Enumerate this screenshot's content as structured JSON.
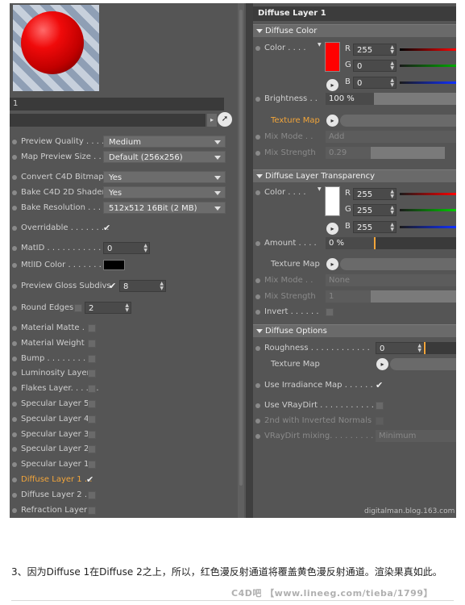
{
  "left_panel": {
    "name_value": "1",
    "rows": [
      {
        "label": "Preview Quality . . . .",
        "value": "Medium",
        "kind": "dropdown"
      },
      {
        "label": "Map Preview Size . .",
        "value": "Default (256x256)",
        "kind": "dropdown"
      },
      {
        "label": "Convert C4D Bitmaps",
        "value": "Yes",
        "kind": "dropdown"
      },
      {
        "label": "Bake C4D 2D Shaders",
        "value": "Yes",
        "kind": "dropdown"
      },
      {
        "label": "Bake Resolution . . . .",
        "value": "512x512  16Bit  (2 MB)",
        "kind": "dropdown"
      },
      {
        "label": "Overridable . . . . . . . .",
        "checked": true
      },
      {
        "label": "MatID . . . . . . . . . . . .",
        "value": "0"
      },
      {
        "label": "MtlID Color . . . . . . . ."
      },
      {
        "label": "Preview Gloss Subdivs",
        "value": "8",
        "checked": true
      },
      {
        "label": "Round Edges",
        "value": "2",
        "checked": false
      }
    ],
    "layers": [
      {
        "label": "Material Matte . .",
        "checked": false
      },
      {
        "label": "Material Weight",
        "checked": false
      },
      {
        "label": "Bump . . . . . . . . . .",
        "checked": false
      },
      {
        "label": "Luminosity Layer",
        "checked": false
      },
      {
        "label": "Flakes Layer. . . . . .",
        "checked": false
      },
      {
        "label": "Specular Layer 5",
        "checked": false
      },
      {
        "label": "Specular Layer 4",
        "checked": false
      },
      {
        "label": "Specular Layer 3",
        "checked": false
      },
      {
        "label": "Specular Layer 2",
        "checked": false
      },
      {
        "label": "Specular Layer 1",
        "checked": false
      },
      {
        "label": "Diffuse Layer 1 . .",
        "checked": true,
        "active": true
      },
      {
        "label": "Diffuse Layer 2 . .",
        "checked": false
      },
      {
        "label": "Refraction Layer",
        "checked": false
      }
    ]
  },
  "right_panel": {
    "title": "Diffuse Layer 1",
    "diffuse_color": {
      "section": "Diffuse Color",
      "color_label": "Color . . . .",
      "color_hex": "#ff0000",
      "r": "255",
      "g": "0",
      "b": "0",
      "brightness_label": "Brightness . .",
      "brightness": "100 %",
      "texture_map_label": "Texture Map",
      "mix_mode_label": "Mix Mode . .",
      "mix_mode_value": "Add",
      "mix_strength_label": "Mix Strength",
      "mix_strength_value": "0.29"
    },
    "transparency": {
      "section": "Diffuse Layer Transparency",
      "color_label": "Color . . . .",
      "color_hex": "#ffffff",
      "r": "255",
      "g": "255",
      "b": "255",
      "amount_label": "Amount . . . .",
      "amount": "0 %",
      "texture_map_label": "Texture Map",
      "mix_mode_label": "Mix Mode . .",
      "mix_mode_value": "None",
      "mix_strength_label": "Mix Strength",
      "mix_strength_value": "1",
      "invert_label": "Invert . . . . . ."
    },
    "options": {
      "section": "Diffuse Options",
      "roughness_label": "Roughness . . . . . . . . . . . .",
      "roughness": "0",
      "texture_map_label": "Texture Map",
      "irradiance_label": "Use Irradiance Map . . . . . .",
      "vraydirt_label": "Use VRayDirt . . . . . . . . . . . .",
      "inverted_normals_label": "2nd with Inverted Normals",
      "vraydirt_mixing_label": "VRayDirt mixing. . . . . . . . . .",
      "vraydirt_mixing_value": "Minimum"
    }
  },
  "watermark": "digitalman.blog.163.com",
  "caption": "3、因为Diffuse 1在Diffuse 2之上，所以，红色漫反射通道将覆盖黄色漫反射通道。渲染果真如此。",
  "footer_watermark": "C4D吧 【www.lineeg.com/tieba/1799】",
  "colors": {
    "active_label": "#f2a53a",
    "panel": "#555555",
    "accent_red": "#ff0000"
  }
}
